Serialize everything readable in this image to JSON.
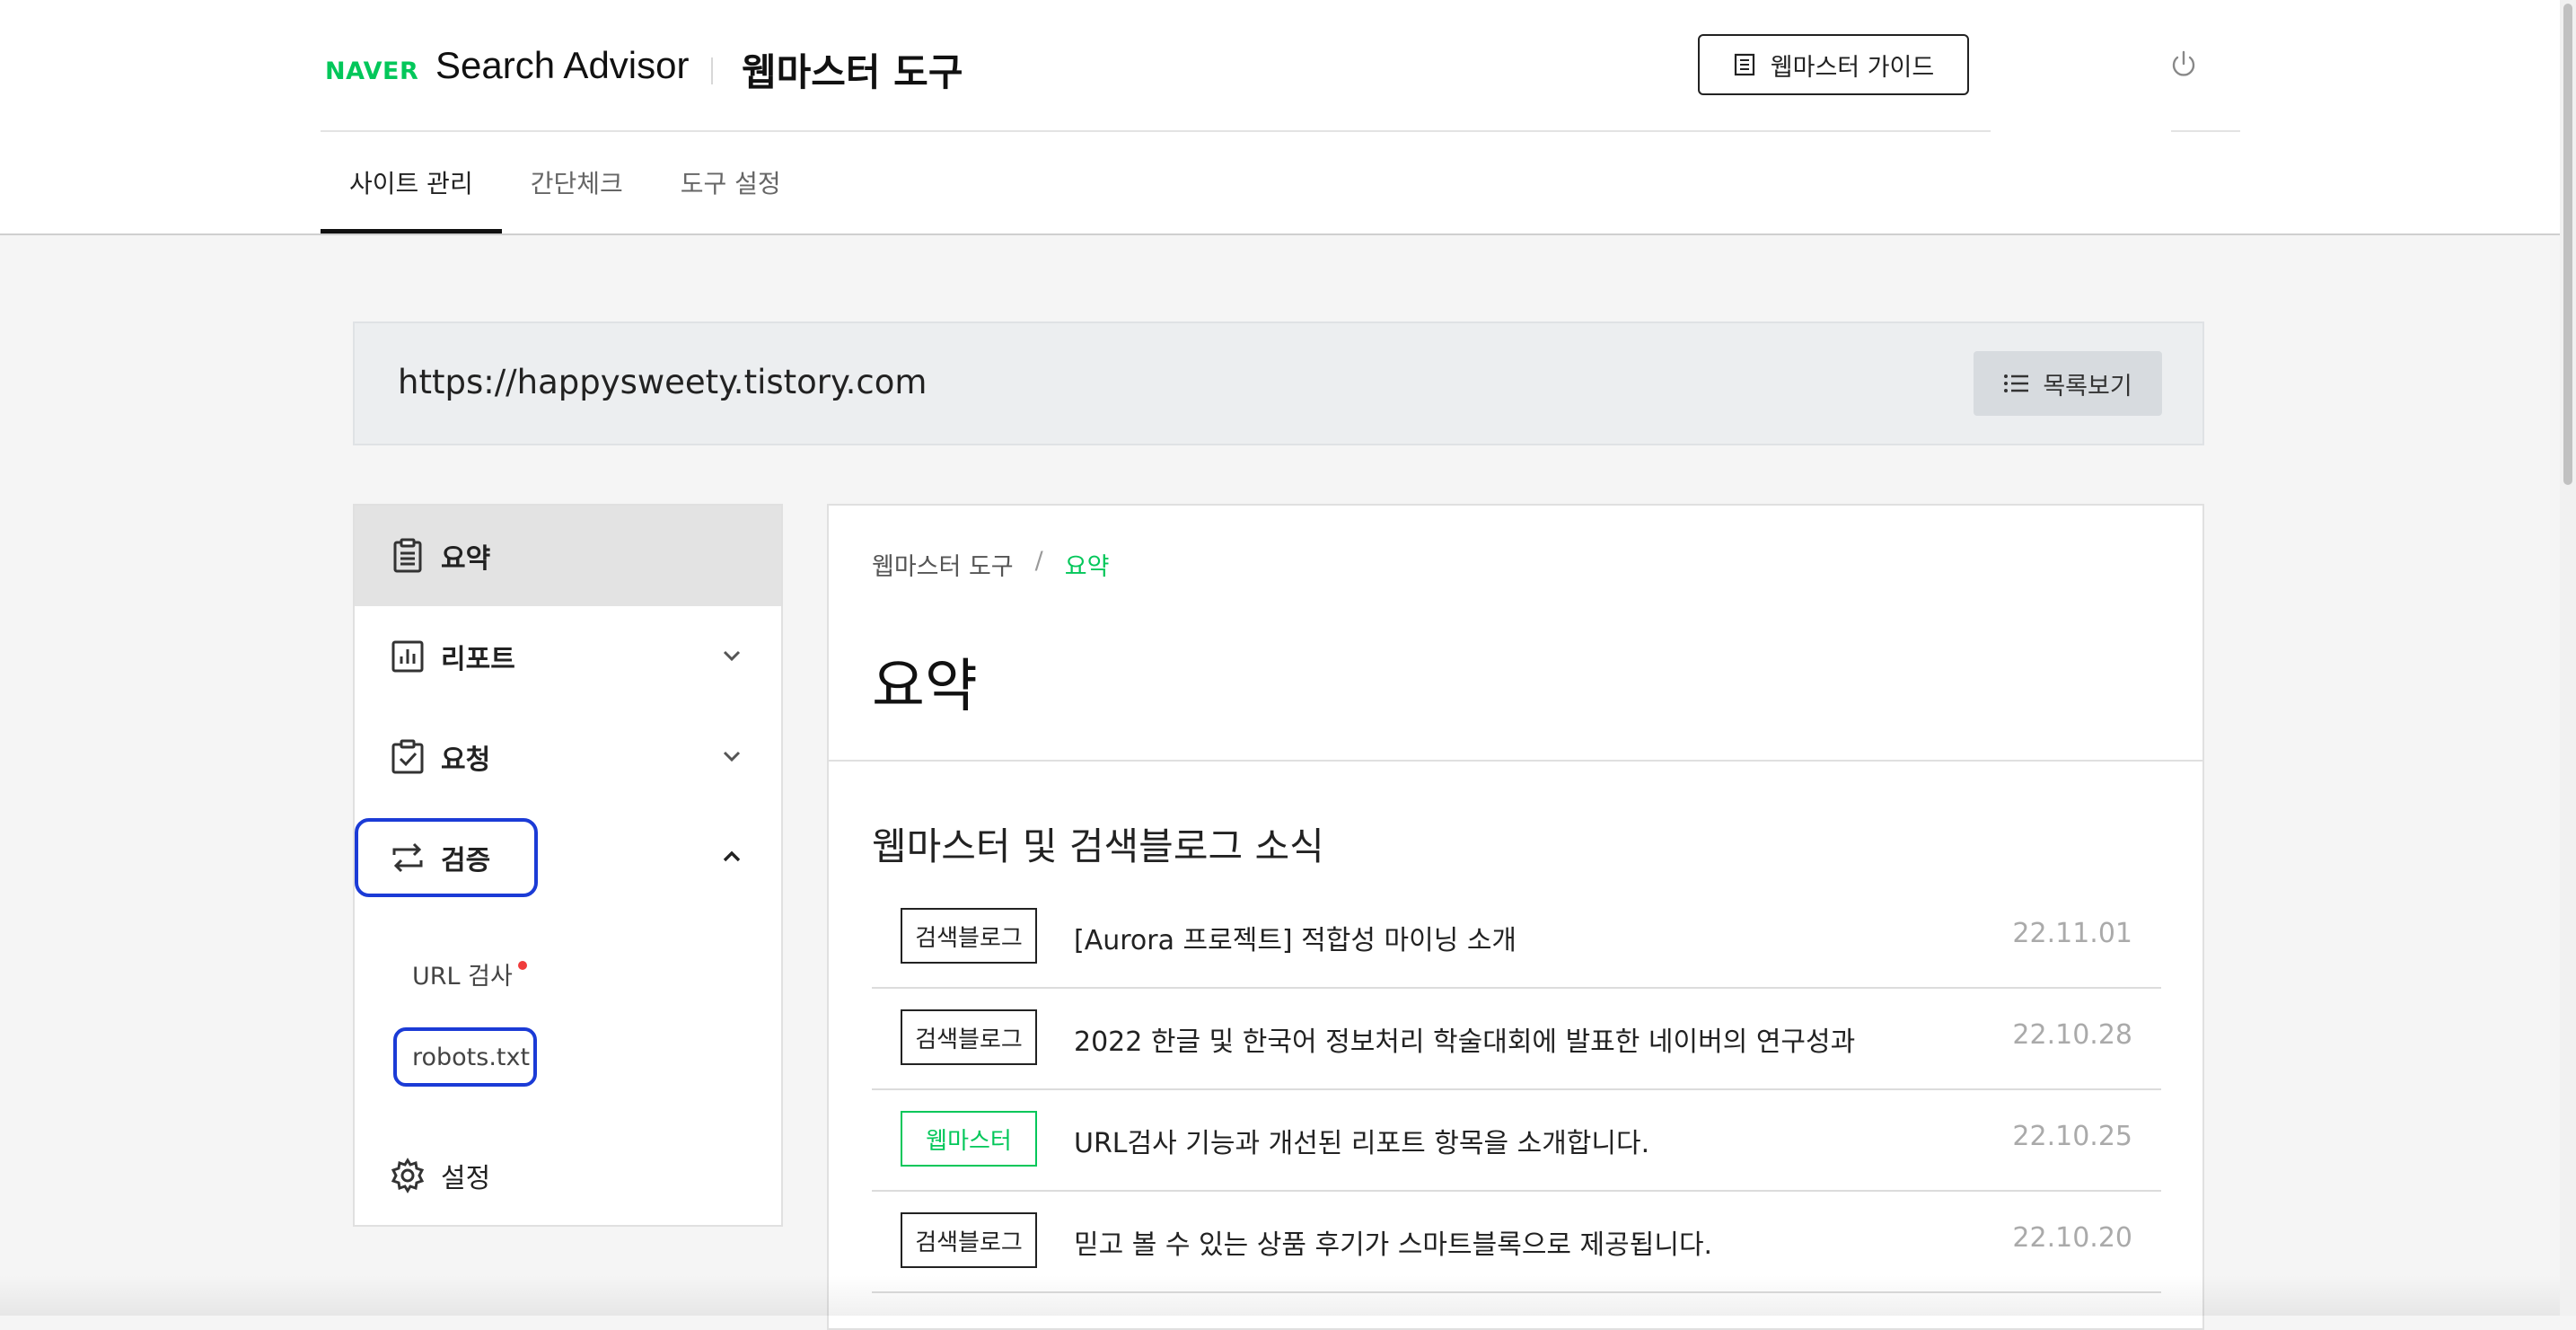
{
  "header": {
    "naver_logo": "NAVER",
    "app_name": "Search Advisor",
    "tool_name": "웹마스터 도구",
    "guide_button": "웹마스터 가이드",
    "nav": [
      "사이트 관리",
      "간단체크",
      "도구 설정"
    ]
  },
  "site": {
    "url": "https://happysweety.tistory.com",
    "list_button": "목록보기"
  },
  "sidebar": {
    "items": [
      {
        "label": "요약",
        "icon": "clipboard-icon"
      },
      {
        "label": "리포트",
        "icon": "bar-chart-icon"
      },
      {
        "label": "요청",
        "icon": "clipboard-check-icon"
      },
      {
        "label": "검증",
        "icon": "repeat-arrows-icon"
      },
      {
        "label": "설정",
        "icon": "gear-icon"
      }
    ],
    "sub_items": [
      "URL 검사",
      "robots.txt"
    ]
  },
  "main": {
    "breadcrumb": [
      "웹마스터 도구",
      "/",
      "요약"
    ],
    "title": "요약",
    "section_title": "웹마스터 및 검색블로그 소식",
    "news": [
      {
        "tag": "검색블로그",
        "title": "[Aurora 프로젝트] 적합성 마이닝 소개",
        "date": "22.11.01"
      },
      {
        "tag": "검색블로그",
        "title": "2022 한글 및 한국어 정보처리 학술대회에 발표한 네이버의 연구성과",
        "date": "22.10.28"
      },
      {
        "tag": "웹마스터",
        "title": "URL검사 기능과 개선된 리포트 항목을 소개합니다.",
        "date": "22.10.25"
      },
      {
        "tag": "검색블로그",
        "title": "믿고 볼 수 있는 상품 후기가 스마트블록으로 제공됩니다.",
        "date": "22.10.20"
      }
    ]
  },
  "colors": {
    "brand_green": "#03c75a",
    "highlight_blue": "#1b3bd6",
    "alert_red": "#f03c3c"
  }
}
